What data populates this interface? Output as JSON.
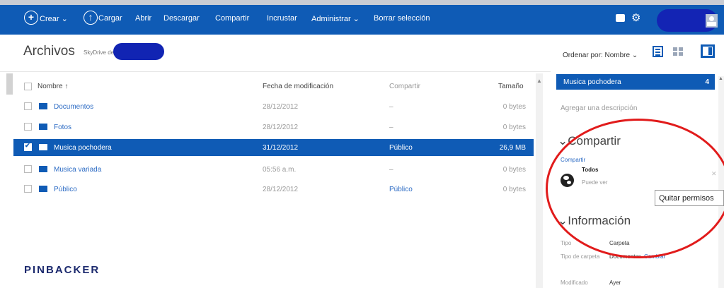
{
  "toolbar": {
    "create_label": "Crear",
    "upload_label": "Cargar",
    "open_label": "Abrir",
    "download_label": "Descargar",
    "share_label": "Compartir",
    "embed_label": "Incrustar",
    "manage_label": "Administrar",
    "clear_selection_label": "Borrar selección"
  },
  "header": {
    "title": "Archivos",
    "subtitle": "SkyDrive de",
    "sort_label": "Ordenar por: Nombre"
  },
  "columns": {
    "name": "Nombre",
    "sort_arrow": "↑",
    "date": "Fecha de modificación",
    "share": "Compartir",
    "size": "Tamaño"
  },
  "files": [
    {
      "name": "Documentos",
      "date": "28/12/2012",
      "share": "–",
      "size": "0 bytes"
    },
    {
      "name": "Fotos",
      "date": "28/12/2012",
      "share": "–",
      "size": "0 bytes"
    },
    {
      "name": "Musica pochodera",
      "date": "31/12/2012",
      "share": "Público",
      "size": "26,9 MB"
    },
    {
      "name": "Musica variada",
      "date": "05:56 a.m.",
      "share": "–",
      "size": "0 bytes"
    },
    {
      "name": "Público",
      "date": "28/12/2012",
      "share": "Público",
      "size": "0 bytes"
    }
  ],
  "watermark": "PINBACKER",
  "details": {
    "selected_name": "Musica pochodera",
    "selected_count": "4",
    "add_description": "Agregar una descripción",
    "share_heading": "Compartir",
    "share_link": "Compartir",
    "share_who": "Todos",
    "share_permission": "Puede ver",
    "remove_permissions_tooltip": "Quitar permisos",
    "info_heading": "Información",
    "type_label": "Tipo",
    "type_value": "Carpeta",
    "folder_type_label": "Tipo de carpeta",
    "folder_type_value": "Documentos",
    "change_link": "Cambiar",
    "modified_label": "Modificado",
    "modified_value": "Ayer"
  },
  "colors": {
    "accent": "#0f5bb5",
    "annotation": "#e11b1b"
  }
}
